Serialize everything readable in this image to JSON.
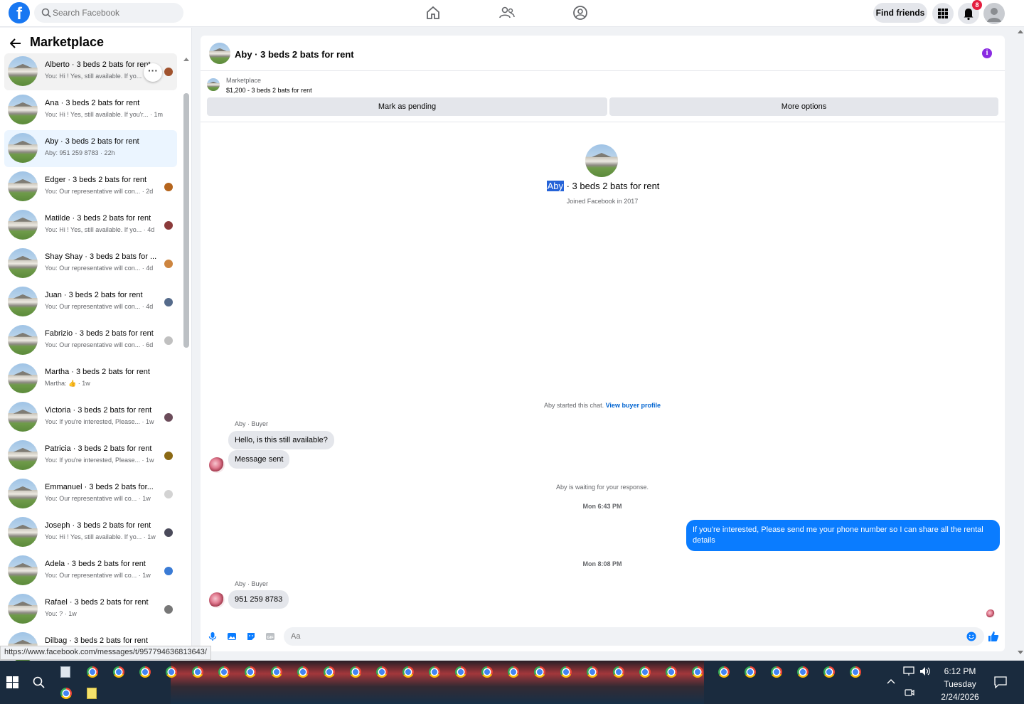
{
  "topbar": {
    "logo": "f",
    "search_placeholder": "Search Facebook",
    "find_friends": "Find friends",
    "notifications_count": "8"
  },
  "sidebar": {
    "title": "Marketplace",
    "conversations": [
      {
        "name": "Alberto · 3 beds 2 bats for rent",
        "snippet": "You: Hi ! Yes, still available. If yo..."
      },
      {
        "name": "Ana · 3 beds 2 bats for rent",
        "snippet": "You: Hi ! Yes, still available. If you'r... · 1m"
      },
      {
        "name": "Aby · 3 beds 2 bats for rent",
        "snippet": "Aby: 951 259 8783 · 22h"
      },
      {
        "name": "Edger · 3 beds 2 bats for rent",
        "snippet": "You: Our representative will con... · 2d"
      },
      {
        "name": "Matilde · 3 beds 2 bats for rent",
        "snippet": "You: Hi ! Yes, still available. If yo... · 4d"
      },
      {
        "name": "Shay Shay · 3 beds 2 bats for ...",
        "snippet": "You: Our representative will con... · 4d"
      },
      {
        "name": "Juan · 3 beds 2 bats for rent",
        "snippet": "You: Our representative will con... · 4d"
      },
      {
        "name": "Fabrizio · 3 beds 2 bats for rent",
        "snippet": "You: Our representative will con... · 6d"
      },
      {
        "name": "Martha · 3 beds 2 bats for rent",
        "snippet": "Martha: 👍 · 1w"
      },
      {
        "name": "Victoria · 3 beds 2 bats for rent",
        "snippet": "You: If you're interested, Please... · 1w"
      },
      {
        "name": "Patricia · 3 beds 2 bats for rent",
        "snippet": "You: If you're interested, Please... · 1w"
      },
      {
        "name": "Emmanuel · 3 beds 2 bats for...",
        "snippet": "You: Our representative will co... · 1w"
      },
      {
        "name": "Joseph · 3 beds 2 bats for rent",
        "snippet": "You: Hi ! Yes, still available. If yo... · 1w"
      },
      {
        "name": "Adela · 3 beds 2 bats for rent",
        "snippet": "You: Our representative will co... · 1w"
      },
      {
        "name": "Rafael · 3 beds 2 bats for rent",
        "snippet": "You: ? · 1w"
      },
      {
        "name": "Dilbag · 3 beds 2 bats for rent",
        "snippet": ""
      }
    ]
  },
  "chat": {
    "header_title": "Aby · 3 beds 2 bats for rent",
    "listing_label": "Marketplace",
    "listing_price": "$1,200 - 3 beds 2 bats for rent",
    "mark_pending": "Mark as pending",
    "more_options": "More options",
    "profile_name_highlight": "Aby",
    "profile_name_rest": " · 3 beds 2 bats for rent",
    "joined": "Joined Facebook in 2017",
    "started_chat": "Aby started this chat.",
    "view_profile": "View buyer profile",
    "sender_label": "Aby · Buyer",
    "msg1": "Hello, is this still available?",
    "msg2": "Message sent",
    "waiting": "Aby is waiting for your response.",
    "time1": "Mon 6:43 PM",
    "msg_out": "If you're interested, Please send me your phone number so I can share all the rental details",
    "time2": "Mon 8:08 PM",
    "sender_label2": "Aby · Buyer",
    "msg3": "951 259 8783",
    "compose_placeholder": "Aa"
  },
  "status_url": "https://www.facebook.com/messages/t/957794636813643/",
  "taskbar": {
    "time": "6:12 PM",
    "day": "Tuesday",
    "date": "2/24/2026"
  },
  "colors": {
    "brand": "#1877f2",
    "outgoing": "#0a7cff",
    "active_conv": "#ebf5ff"
  }
}
